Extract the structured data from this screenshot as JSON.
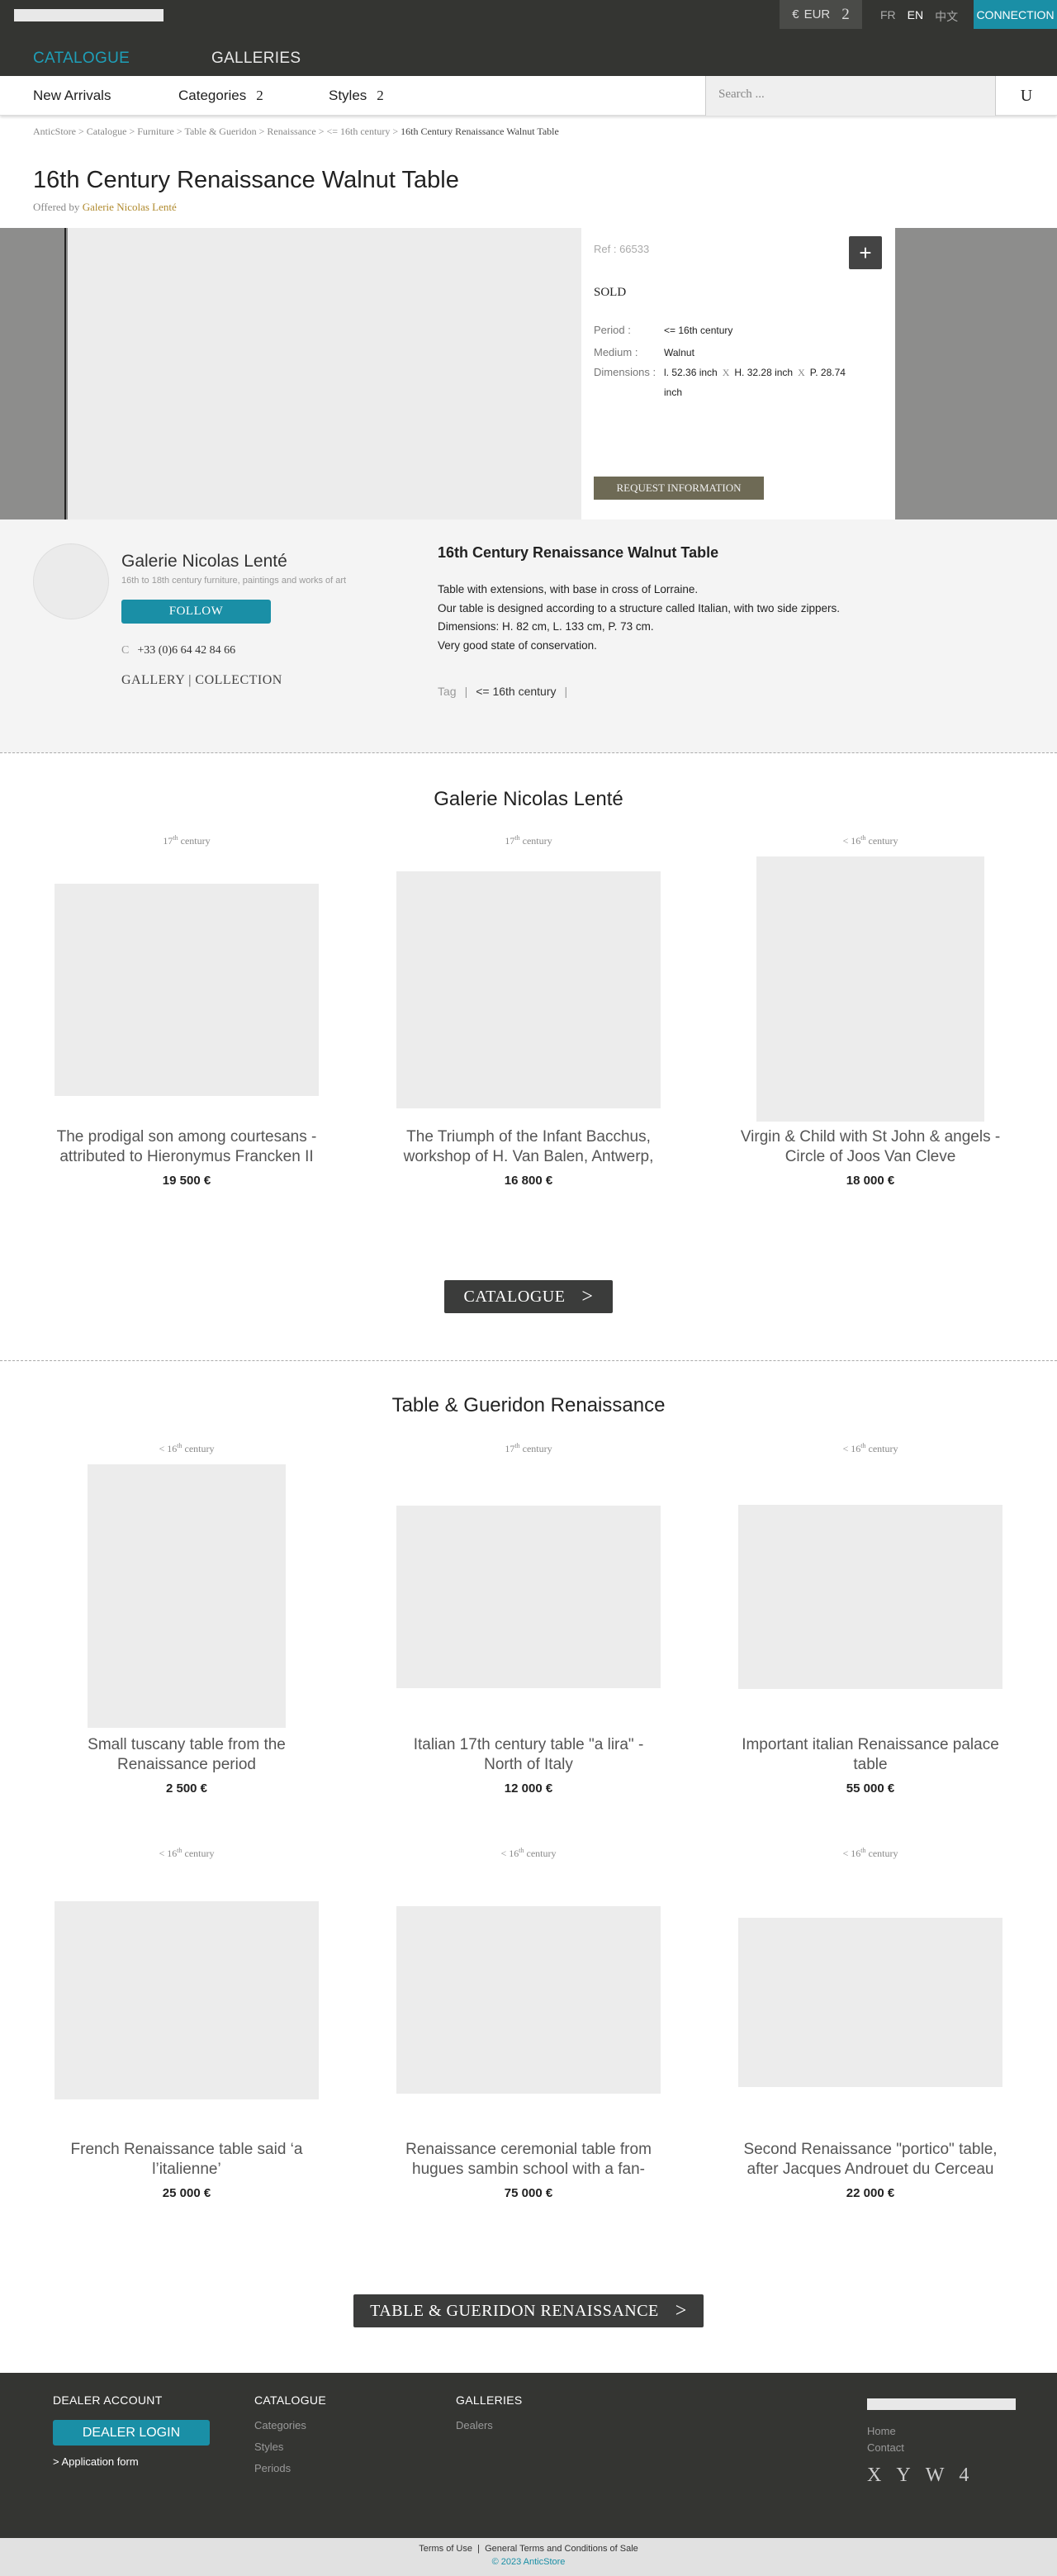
{
  "header": {
    "currency": "EUR",
    "currency_symbol": "€",
    "currency_chevron": "2",
    "languages": [
      "FR",
      "EN",
      "中文"
    ],
    "connection": "CONNECTION",
    "nav": {
      "catalogue": "CATALOGUE",
      "galleries": "GALLERIES"
    }
  },
  "subnav": {
    "new_arrivals": "New Arrivals",
    "categories": "Categories",
    "styles": "Styles",
    "chevron": "2",
    "search_placeholder": "Search ...",
    "search_icon": "U"
  },
  "breadcrumb": {
    "items": [
      "AnticStore",
      "Catalogue",
      "Furniture",
      "Table & Gueridon",
      "Renaissance",
      "<= 16th century"
    ],
    "separator": ">",
    "current": "16th Century Renaissance Walnut Table"
  },
  "product": {
    "title": "16th Century Renaissance Walnut Table",
    "offered_by_label": "Offered by",
    "dealer": "Galerie Nicolas Lenté",
    "ref": "Ref : 66533",
    "plus": "+",
    "status": "SOLD",
    "period_label": "Period :",
    "period": "<= 16th century",
    "medium_label": "Medium :",
    "medium": "Walnut",
    "dimensions_label": "Dimensions :",
    "dim_l": "l. 52.36 inch",
    "dim_h": "H. 32.28 inch",
    "dim_p": "P. 28.74",
    "dim_unit": "inch",
    "dim_sep": "X",
    "request_button": "REQUEST INFORMATION"
  },
  "dealer": {
    "name": "Galerie Nicolas Lenté",
    "subtitle": "16th to 18th century furniture, paintings and works of art",
    "follow": "FOLLOW",
    "phone_icon": "C",
    "phone": "+33 (0)6 64 42 84 66",
    "link_gallery": "GALLERY",
    "link_separator": "|",
    "link_collection": "COLLECTION"
  },
  "description": {
    "title": "16th Century Renaissance Walnut Table",
    "lines": [
      "Table with extensions, with base in cross of Lorraine.",
      "Our table is designed according to a structure called Italian, with two side zippers.",
      "Dimensions: H. 82 cm, L. 133 cm, P. 73 cm.",
      "Very good state of conservation."
    ],
    "tag_label": "Tag",
    "tag_sep": "|",
    "tags": [
      "<= 16th century"
    ]
  },
  "section_dealer": {
    "title": "Galerie Nicolas Lenté",
    "items": [
      {
        "prefix": "",
        "century": "17",
        "sup": "th",
        "suffix": "century",
        "title_1": "The prodigal son among courtesans -",
        "title_2": "attributed to Hieronymus Francken II",
        "price": "19 500 €"
      },
      {
        "prefix": "",
        "century": "17",
        "sup": "th",
        "suffix": "century",
        "title_1": "The Triumph of the Infant Bacchus,",
        "title_2": "workshop of H. Van Balen, Antwerp,",
        "price": "16 800 €"
      },
      {
        "prefix": "<",
        "century": "16",
        "sup": "th",
        "suffix": "century",
        "title_1": "Virgin & Child with St John & angels -",
        "title_2": "Circle of Joos Van Cleve",
        "price": "18 000 €"
      }
    ],
    "button": "CATALOGUE",
    "button_arrow": ">"
  },
  "section_category": {
    "title": "Table & Gueridon Renaissance",
    "items": [
      {
        "prefix": "<",
        "century": "16",
        "sup": "th",
        "suffix": "century",
        "title_1": "Small tuscany table from the",
        "title_2": "Renaissance period",
        "price": "2 500 €"
      },
      {
        "prefix": "",
        "century": "17",
        "sup": "th",
        "suffix": "century",
        "title_1": "Italian 17th century table \"a lira\" -",
        "title_2": "North of Italy",
        "price": "12 000 €"
      },
      {
        "prefix": "<",
        "century": "16",
        "sup": "th",
        "suffix": "century",
        "title_1": "Important italian Renaissance palace",
        "title_2": "table",
        "price": "55 000 €"
      },
      {
        "prefix": "<",
        "century": "16",
        "sup": "th",
        "suffix": "century",
        "title_1": "French Renaissance table said ‘a",
        "title_2": "l’italienne’",
        "price": "25 000 €"
      },
      {
        "prefix": "<",
        "century": "16",
        "sup": "th",
        "suffix": "century",
        "title_1": "Renaissance ceremonial table from",
        "title_2": "hugues sambin school with a fan-",
        "price": "75 000 €"
      },
      {
        "prefix": "<",
        "century": "16",
        "sup": "th",
        "suffix": "century",
        "title_1": "Second Renaissance \"portico\" table,",
        "title_2": "after Jacques Androuet du Cerceau",
        "price": "22 000 €"
      }
    ],
    "button": "TABLE & GUERIDON RENAISSANCE",
    "button_arrow": ">"
  },
  "footer": {
    "dealer_account": "DEALER ACCOUNT",
    "dealer_login": "DEALER LOGIN",
    "application_form": "> Application form",
    "catalogue": "CATALOGUE",
    "catalogue_links": [
      "Categories",
      "Styles",
      "Periods"
    ],
    "galleries": "GALLERIES",
    "galleries_links": [
      "Dealers"
    ],
    "home": "Home",
    "contact": "Contact",
    "socials": [
      "X",
      "Y",
      "W",
      "4"
    ],
    "terms": "Terms of Use",
    "sep": "|",
    "conditions": "General Terms and Conditions of Sale",
    "copyright": "© 2023 AnticStore"
  },
  "colors": {
    "dark": "#343532",
    "accent": "#1a8fa6",
    "dealer_link": "#b08a2e"
  }
}
